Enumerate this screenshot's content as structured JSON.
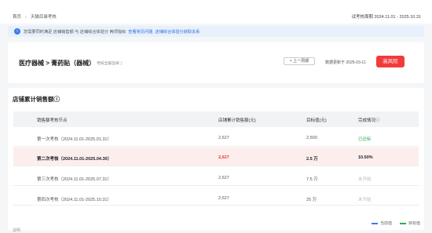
{
  "breadcrumb": {
    "home": "首页",
    "current": "天猫目录考核"
  },
  "period": "试考核周期 2024.11.01 - 2025.10.31",
  "notice": {
    "text": "您需要同时满足 店铺销售额 与 店铺综合体验分 两项指标",
    "link1": "查看常见问题",
    "link2": "店铺综合体验分获取关系"
  },
  "category": {
    "title": "医疗器械 > 膏药贴（器械）",
    "scope": "考核全部品目ⓘ",
    "prev_button": "< 上一周期",
    "updated": "数据更新于 2025-03-11",
    "risk_label": "高风险"
  },
  "sales": {
    "title": "店铺累计销售额ⓘ",
    "headers": [
      "销售额考核节点",
      "店铺累计销售额(元)",
      "目标值(元)",
      "完成情况ⓘ"
    ],
    "rows": [
      {
        "node": "第一次考核（2024.11.01-2025.01.31）",
        "sales": "2,627",
        "target": "2,500",
        "status": "已达标"
      },
      {
        "node": "第二次考核（2024.11.01-2025.04.30）",
        "sales": "2,627",
        "target": "2.5 万",
        "status": "10.50%"
      },
      {
        "node": "第三次考核（2024.11.01-2025.07.31）",
        "sales": "2,627",
        "target": "7.5 万",
        "status": "未开始"
      },
      {
        "node": "第四次考核（2024.11.01-2025.10.31）",
        "sales": "2,627",
        "target": "25 万",
        "status": "未开始"
      }
    ],
    "legend": [
      "当前值",
      "目标值"
    ]
  },
  "footer_fragment": "说明"
}
